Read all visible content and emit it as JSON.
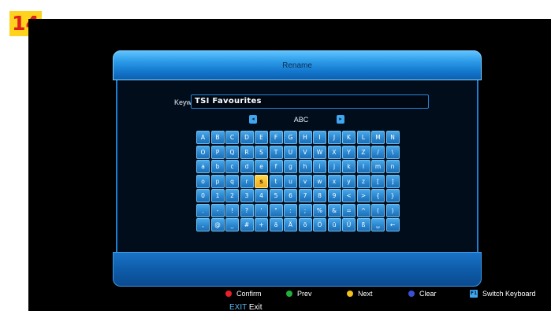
{
  "step_badge": "14",
  "dialog": {
    "title": "Rename",
    "keyword_label": "Keyword",
    "keyword_value": "TSI Favourites",
    "keyboard_mode": "ABC",
    "page_prev_icon": "page-left-icon",
    "page_next_icon": "page-right-icon",
    "selected_key": "s"
  },
  "keyboard": {
    "rows": [
      [
        "A",
        "B",
        "C",
        "D",
        "E",
        "F",
        "G",
        "H",
        "I",
        "J",
        "K",
        "L",
        "M",
        "N"
      ],
      [
        "O",
        "P",
        "Q",
        "R",
        "S",
        "T",
        "U",
        "V",
        "W",
        "X",
        "Y",
        "Z",
        "/",
        "\\"
      ],
      [
        "a",
        "b",
        "c",
        "d",
        "e",
        "f",
        "g",
        "h",
        "i",
        "j",
        "k",
        "l",
        "m",
        "n"
      ],
      [
        "o",
        "p",
        "q",
        "r",
        "s",
        "t",
        "u",
        "v",
        "w",
        "x",
        "y",
        "z",
        "[",
        "]"
      ],
      [
        "0",
        "1",
        "2",
        "3",
        "4",
        "5",
        "6",
        "7",
        "8",
        "9",
        "<",
        ">",
        "{",
        "}"
      ],
      [
        ".",
        "-",
        "!",
        "?",
        "'",
        "\"",
        ":",
        ";",
        "%",
        "&",
        "=",
        "^",
        "(",
        ")"
      ],
      [
        ",",
        "@",
        "_",
        "#",
        "+",
        "ä",
        "Ä",
        "ö",
        "Ö",
        "ü",
        "Ü",
        "ß",
        "␣",
        "←"
      ]
    ]
  },
  "footer": {
    "legend": [
      {
        "id": "confirm",
        "label": "Confirm",
        "color": "#e8202a"
      },
      {
        "id": "prev",
        "label": "Prev",
        "color": "#22b03a"
      },
      {
        "id": "next",
        "label": "Next",
        "color": "#f2c21a"
      },
      {
        "id": "clear",
        "label": "Clear",
        "color": "#3a4fd8"
      },
      {
        "id": "switch",
        "label": "Switch Keyboard",
        "badge": "F1"
      }
    ],
    "exit_key": "EXIT",
    "exit_label": "Exit"
  }
}
